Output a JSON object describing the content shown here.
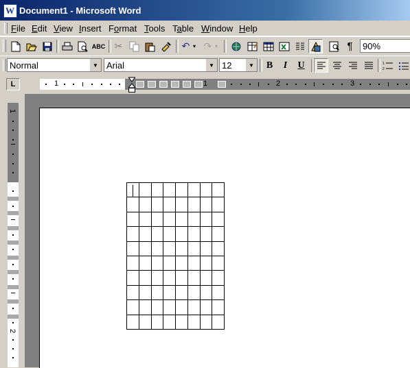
{
  "window": {
    "title": "Document1 - Microsoft Word",
    "app_icon_letter": "W"
  },
  "menu": {
    "items": [
      {
        "label": "File",
        "mnemonic": "F"
      },
      {
        "label": "Edit",
        "mnemonic": "E"
      },
      {
        "label": "View",
        "mnemonic": "V"
      },
      {
        "label": "Insert",
        "mnemonic": "I"
      },
      {
        "label": "Format",
        "mnemonic": "o"
      },
      {
        "label": "Tools",
        "mnemonic": "T"
      },
      {
        "label": "Table",
        "mnemonic": "a"
      },
      {
        "label": "Window",
        "mnemonic": "W"
      },
      {
        "label": "Help",
        "mnemonic": "H"
      }
    ]
  },
  "standard_toolbar": {
    "icons": [
      "new-icon",
      "open-icon",
      "save-icon",
      "print-icon",
      "print-preview-icon",
      "spelling-icon",
      "cut-icon",
      "copy-icon",
      "paste-icon",
      "format-painter-icon",
      "undo-icon",
      "redo-icon",
      "hyperlink-icon",
      "tables-borders-icon",
      "insert-table-icon",
      "insert-excel-icon",
      "columns-icon",
      "drawing-icon",
      "document-map-icon",
      "show-hide-icon"
    ],
    "show_hide_glyph": "¶",
    "zoom": "90%"
  },
  "formatting_toolbar": {
    "style": "Normal",
    "font": "Arial",
    "size": "12",
    "bold": "B",
    "italic": "I",
    "underline": "U"
  },
  "ruler": {
    "corner_label": "L",
    "numbers": [
      "1",
      "1",
      "2",
      "3"
    ]
  },
  "vertical_ruler": {
    "numbers": [
      "1",
      "2"
    ]
  },
  "document": {
    "table": {
      "rows": 10,
      "columns": 8
    }
  }
}
